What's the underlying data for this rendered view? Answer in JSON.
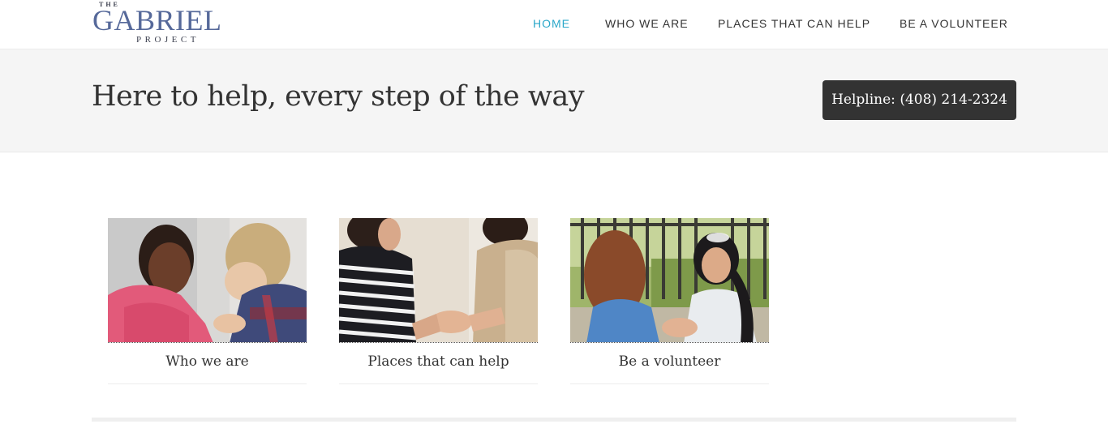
{
  "header": {
    "logo": {
      "the": "THE",
      "main": "GABRIEL",
      "sub": "PROJECT"
    },
    "nav": [
      {
        "label": "HOME",
        "active": true
      },
      {
        "label": "WHO WE ARE",
        "active": false
      },
      {
        "label": "PLACES THAT CAN HELP",
        "active": false
      },
      {
        "label": "BE A VOLUNTEER",
        "active": false
      }
    ],
    "active_color": "#2aa7c9"
  },
  "banner": {
    "title": "Here to help, every step of the way",
    "helpline": "Helpline: (408) 214-2324"
  },
  "cards": [
    {
      "label": "Who we are"
    },
    {
      "label": "Places that can help"
    },
    {
      "label": "Be a volunteer"
    }
  ]
}
